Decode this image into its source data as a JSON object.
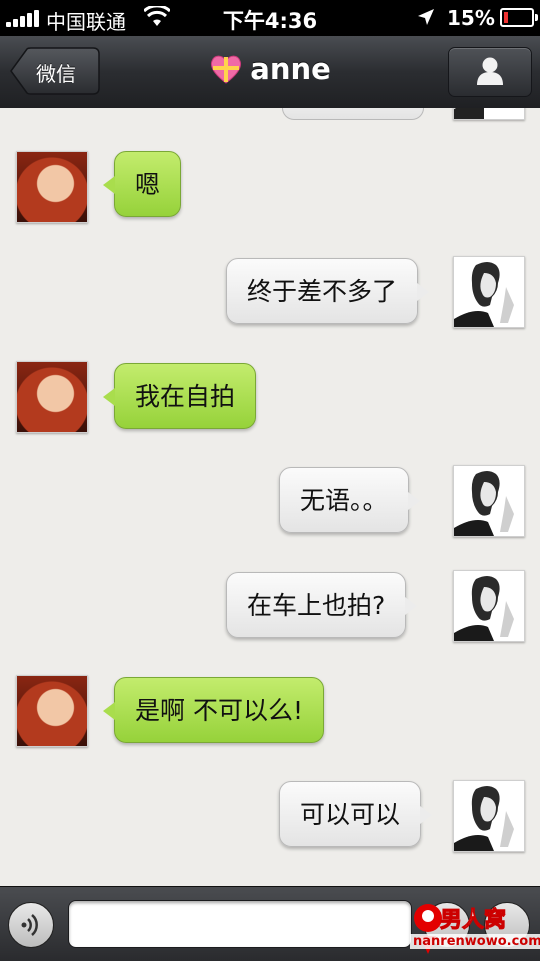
{
  "status_bar": {
    "carrier": "中国联通",
    "time": "下午4:36",
    "battery": "15%"
  },
  "nav": {
    "back_label": "微信",
    "title": "anne"
  },
  "messages": [
    {
      "side": "left",
      "text": "嗯"
    },
    {
      "side": "right",
      "text": "终于差不多了"
    },
    {
      "side": "left",
      "text": "我在自拍"
    },
    {
      "side": "right",
      "text": "无语。。"
    },
    {
      "side": "right",
      "text": "在车上也拍?"
    },
    {
      "side": "left",
      "text": "是啊 不可以么!"
    },
    {
      "side": "right",
      "text": "可以可以"
    }
  ],
  "input": {
    "placeholder": ""
  },
  "watermark": {
    "brand": "男人窝",
    "url": "nanrenwowo.com"
  },
  "colors": {
    "incoming_bubble": "#a8dc4c",
    "outgoing_bubble": "#efefef",
    "navbar": "#2b2d31"
  }
}
